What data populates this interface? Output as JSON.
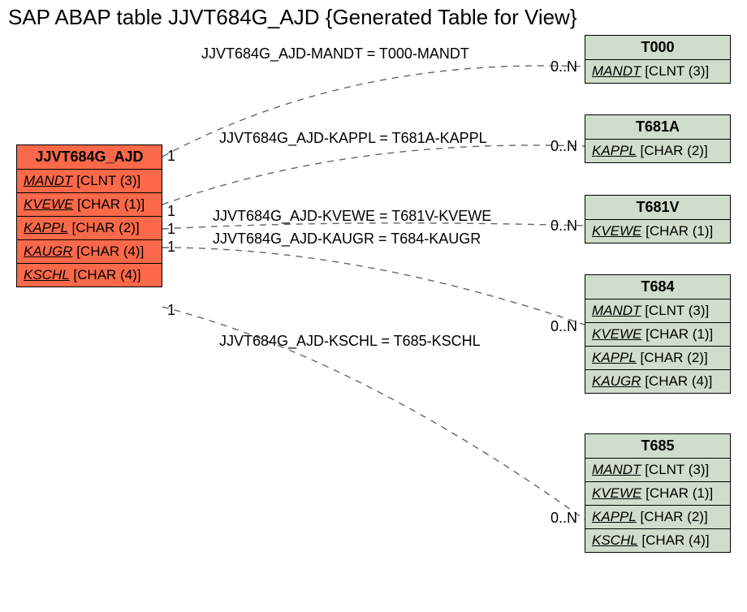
{
  "title": "SAP ABAP table JJVT684G_AJD {Generated Table for View}",
  "source": {
    "name": "JJVT684G_AJD",
    "fields": [
      {
        "field": "MANDT",
        "type": "[CLNT (3)]"
      },
      {
        "field": "KVEWE",
        "type": "[CHAR (1)]"
      },
      {
        "field": "KAPPL",
        "type": "[CHAR (2)]"
      },
      {
        "field": "KAUGR",
        "type": "[CHAR (4)]"
      },
      {
        "field": "KSCHL",
        "type": "[CHAR (4)]"
      }
    ]
  },
  "targets": [
    {
      "name": "T000",
      "fields": [
        {
          "field": "MANDT",
          "type": "[CLNT (3)]"
        }
      ]
    },
    {
      "name": "T681A",
      "fields": [
        {
          "field": "KAPPL",
          "type": "[CHAR (2)]"
        }
      ]
    },
    {
      "name": "T681V",
      "fields": [
        {
          "field": "KVEWE",
          "type": "[CHAR (1)]"
        }
      ]
    },
    {
      "name": "T684",
      "fields": [
        {
          "field": "MANDT",
          "type": "[CLNT (3)]"
        },
        {
          "field": "KVEWE",
          "type": "[CHAR (1)]"
        },
        {
          "field": "KAPPL",
          "type": "[CHAR (2)]"
        },
        {
          "field": "KAUGR",
          "type": "[CHAR (4)]"
        }
      ]
    },
    {
      "name": "T685",
      "fields": [
        {
          "field": "MANDT",
          "type": "[CLNT (3)]"
        },
        {
          "field": "KVEWE",
          "type": "[CHAR (1)]"
        },
        {
          "field": "KAPPL",
          "type": "[CHAR (2)]"
        },
        {
          "field": "KSCHL",
          "type": "[CHAR (4)]"
        }
      ]
    }
  ],
  "relations": [
    {
      "label": "JJVT684G_AJD-MANDT = T000-MANDT",
      "src_card": "1",
      "tgt_card": "0..N"
    },
    {
      "label": "JJVT684G_AJD-KAPPL = T681A-KAPPL",
      "src_card": "1",
      "tgt_card": "0..N"
    },
    {
      "label": "JJVT684G_AJD-KVEWE = T681V-KVEWE",
      "src_card": "1",
      "tgt_card": "0..N"
    },
    {
      "label": "JJVT684G_AJD-KAUGR = T684-KAUGR",
      "src_card": "1",
      "tgt_card": "0..N"
    },
    {
      "label": "JJVT684G_AJD-KSCHL = T685-KSCHL",
      "src_card": "1",
      "tgt_card": "0..N"
    }
  ]
}
